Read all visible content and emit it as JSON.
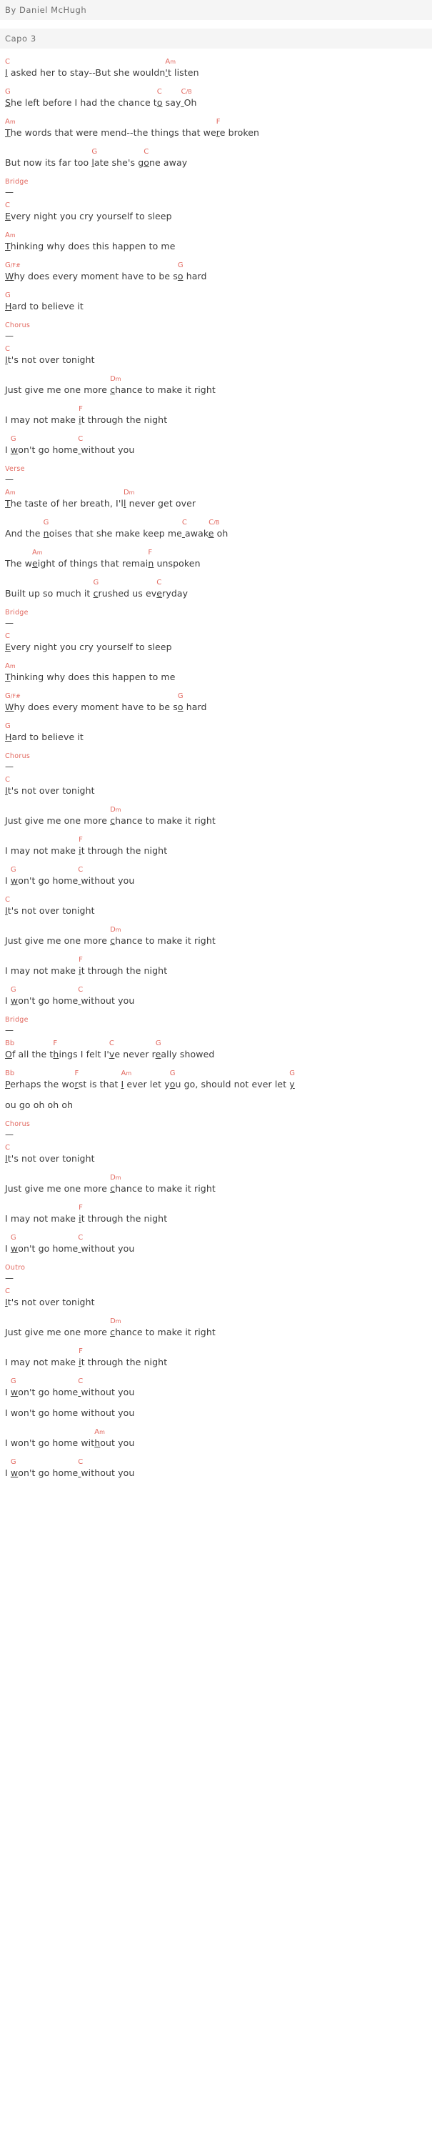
{
  "header": {
    "byline": "By Daniel McHugh",
    "capo": "Capo 3"
  },
  "labels": {
    "bridge": "Bridge",
    "chorus": "Chorus",
    "verse": "Verse",
    "outro": "Outro",
    "rule": "—"
  },
  "colors": {
    "chord": "#e2685f",
    "lyric": "#3a3a3a",
    "banner_bg": "#f5f5f5",
    "banner_text": "#6f6f6f",
    "page_bg": "#ffffff"
  },
  "lines": [
    {
      "id": "v1l1",
      "chords": "C                                   Am",
      "lyric": "I asked her to stay--But she wouldn't listen",
      "marks": [
        0,
        35
      ]
    },
    {
      "id": "v1l2",
      "chords": "G                                 C   C/B",
      "lyric": "She left before I had the chance to say Oh",
      "marks": [
        0,
        34,
        39
      ]
    },
    {
      "id": "v1l3",
      "chords": "Am                                   F",
      "lyric": "The words that were mend--the things that were broken",
      "marks": [
        0,
        44
      ]
    },
    {
      "id": "v1l4",
      "chords": "                    G           C",
      "lyric": "But now its far too late she's gone away",
      "marks": [
        20,
        32
      ]
    },
    {
      "id": "b1l1",
      "chords": "C",
      "lyric": "Every night you cry yourself to sleep",
      "marks": [
        0
      ]
    },
    {
      "id": "b1l2",
      "chords": "Am",
      "lyric": "Thinking why does this happen to me",
      "marks": [
        0
      ]
    },
    {
      "id": "b1l3",
      "chords": "G/F#                            G",
      "lyric": "Why does every moment have to be so hard",
      "marks": [
        0,
        34
      ]
    },
    {
      "id": "b1l4",
      "chords": "G",
      "lyric": "Hard to believe it",
      "marks": [
        0
      ]
    },
    {
      "id": "c1l1",
      "chords": "C",
      "lyric": "It's not over tonight",
      "marks": [
        0
      ]
    },
    {
      "id": "c1l2",
      "chords": "                      Dm",
      "lyric": "Just give me one more chance to make it right",
      "marks": [
        22
      ]
    },
    {
      "id": "c1l3",
      "chords": "               F",
      "lyric": "I may not make it through the night",
      "marks": [
        15
      ]
    },
    {
      "id": "c1l4",
      "chords": " G            C",
      "lyric": "I won't go home without you",
      "marks": [
        2,
        15
      ]
    },
    {
      "id": "v2l1",
      "chords": "Am                            Dm",
      "lyric": "The taste of her breath, I'll never get over",
      "marks": [
        0,
        28
      ]
    },
    {
      "id": "v2l2",
      "chords": "       G                         C    C/B",
      "lyric": "And the noises that she make keep me awake oh",
      "marks": [
        8,
        36,
        41
      ]
    },
    {
      "id": "v2l3",
      "chords": "     Am                        F",
      "lyric": "The weight of things that remain unspoken",
      "marks": [
        5,
        31
      ]
    },
    {
      "id": "v2l4",
      "chords": "                   G              C",
      "lyric": "Built up so much it crushed us everyday",
      "marks": [
        20,
        33
      ]
    },
    {
      "id": "br2l1",
      "chords": "Bb          F              C         G",
      "lyric": "Of all the things I felt I've never really showed",
      "marks": [
        0,
        12,
        27,
        37
      ]
    },
    {
      "id": "br2l2",
      "chords": "Bb            F           Am        G                      G",
      "lyric": "Perhaps the worst is that I ever let you go, should not ever let y",
      "marks": [
        0,
        14,
        26,
        38,
        65
      ]
    },
    {
      "id": "br2l3",
      "chords": "",
      "lyric": "ou go oh oh oh",
      "marks": []
    },
    {
      "id": "o1",
      "chords": "",
      "lyric": "I won't go home without you",
      "marks": []
    },
    {
      "id": "o2",
      "chords": "                   Am",
      "lyric": "I won't go home without you",
      "marks": [
        19
      ]
    }
  ],
  "document_order": [
    "verse1",
    "bridge1",
    "chorus1",
    "verse2",
    "bridge2",
    "chorus2",
    "chorus3",
    "bridge3",
    "chorus4",
    "outro"
  ]
}
